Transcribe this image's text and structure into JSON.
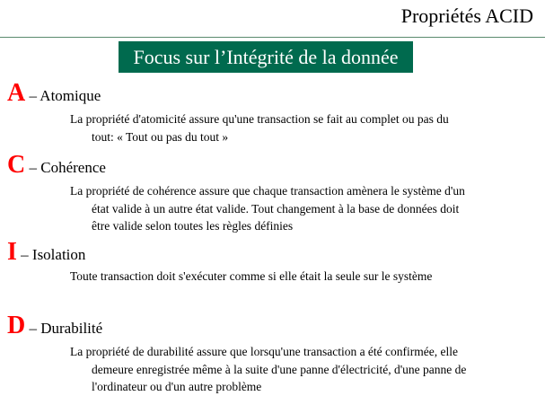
{
  "title": "Propriétés ACID",
  "banner": "Focus sur l’Intégrité de la donnée",
  "sections": [
    {
      "letter": "A",
      "label": " – Atomique",
      "lines": [
        "La propriété d'atomicité assure qu'une transaction se fait au complet ou pas du",
        "tout: « Tout ou pas du tout »"
      ]
    },
    {
      "letter": "C",
      "label": " – Cohérence",
      "lines": [
        "La propriété de cohérence assure que chaque transaction amènera le système d'un",
        "état valide à un autre état valide. Tout changement à la base de données doit",
        "être valide selon toutes les règles définies"
      ]
    },
    {
      "letter": "I",
      "label": " – Isolation",
      "lines": [
        "Toute transaction doit s'exécuter comme si elle était la seule sur le système"
      ]
    },
    {
      "letter": "D",
      "label": " – Durabilité",
      "lines": [
        "La propriété de durabilité assure que lorsqu'une transaction a été confirmée, elle",
        "demeure enregistrée même à la suite d'une panne d'électricité, d'une panne de",
        "l'ordinateur ou d'un autre problème"
      ]
    }
  ],
  "colors": {
    "banner": "#006a4e",
    "letter": "#ff0000",
    "rule": "#5a8a6e"
  }
}
